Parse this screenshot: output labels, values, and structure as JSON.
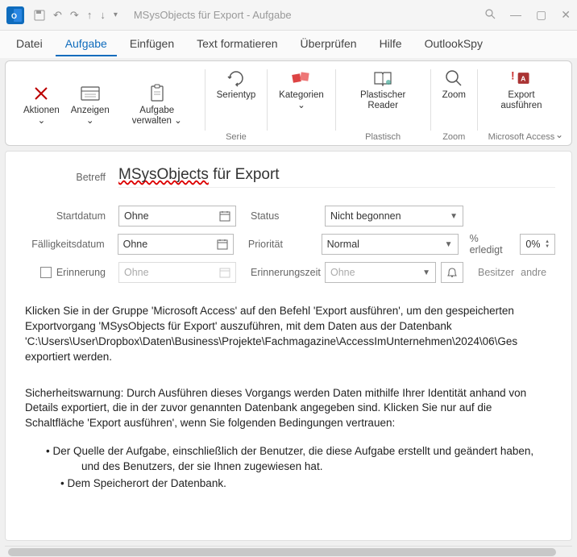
{
  "titlebar": {
    "app_abbr": "O",
    "title": "MSysObjects für Export  -  Aufgabe"
  },
  "menu": {
    "items": [
      {
        "label": "Datei",
        "active": false
      },
      {
        "label": "Aufgabe",
        "active": true
      },
      {
        "label": "Einfügen",
        "active": false
      },
      {
        "label": "Text formatieren",
        "active": false
      },
      {
        "label": "Überprüfen",
        "active": false
      },
      {
        "label": "Hilfe",
        "active": false
      },
      {
        "label": "OutlookSpy",
        "active": false
      }
    ]
  },
  "ribbon": {
    "buttons": {
      "aktionen": "Aktionen",
      "anzeigen": "Anzeigen",
      "aufgabe_verwalten": "Aufgabe verwalten",
      "serientyp": "Serientyp",
      "kategorien": "Kategorien",
      "plastischer_reader": "Plastischer Reader",
      "zoom": "Zoom",
      "export_ausfuehren": "Export ausführen"
    },
    "groups": {
      "serie": "Serie",
      "plastisch": "Plastisch",
      "zoom": "Zoom",
      "access": "Microsoft Access"
    }
  },
  "form": {
    "labels": {
      "betreff": "Betreff",
      "startdatum": "Startdatum",
      "faelligkeitsdatum": "Fälligkeitsdatum",
      "status": "Status",
      "prioritaet": "Priorität",
      "erinnerung": "Erinnerung",
      "erinnerungszeit": "Erinnerungszeit",
      "pct_erledigt": "% erledigt",
      "besitzer": "Besitzer"
    },
    "values": {
      "subject_word1": "MSysObjects",
      "subject_rest": " für Export",
      "startdatum": "Ohne",
      "faelligkeitsdatum": "Ohne",
      "status": "Nicht begonnen",
      "prioritaet": "Normal",
      "erinnerung_date": "Ohne",
      "erinnerung_time": "Ohne",
      "pct": "0%",
      "besitzer": "andre"
    }
  },
  "body": {
    "p1": "Klicken Sie in der Gruppe 'Microsoft Access' auf den Befehl 'Export ausführen', um den gespeicherten Exportvorgang 'MSysObjects für Export' auszuführen, mit dem Daten aus der Datenbank 'C:\\Users\\User\\Dropbox\\Daten\\Business\\Projekte\\Fachmagazine\\AccessImUnternehmen\\2024\\06\\Ges exportiert werden.",
    "p2": "Sicherheitswarnung: Durch Ausführen dieses Vorgangs werden Daten mithilfe Ihrer Identität anhand von Details exportiert, die in der zuvor genannten Datenbank angegeben sind. Klicken Sie nur auf die Schaltfläche 'Export ausführen', wenn Sie folgenden Bedingungen vertrauen:",
    "b1": "• Der Quelle der Aufgabe, einschließlich der Benutzer, die diese Aufgabe erstellt und geändert haben, und des Benutzers, der sie Ihnen zugewiesen hat.",
    "b2": "• Dem Speicherort der Datenbank."
  }
}
